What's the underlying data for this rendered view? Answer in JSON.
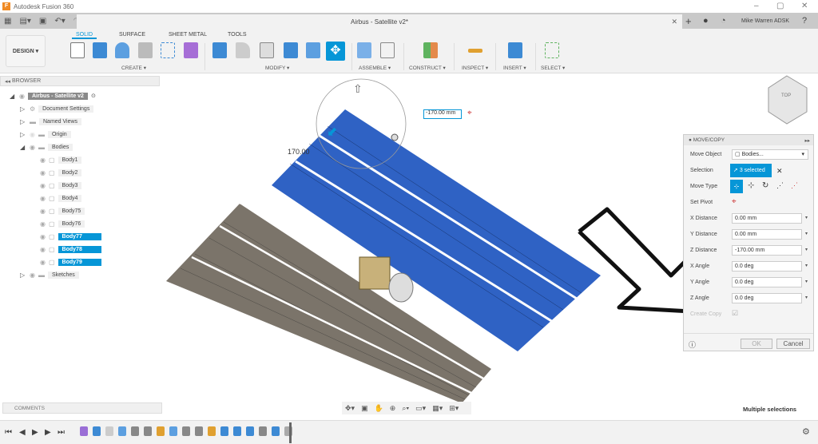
{
  "app": {
    "title": "Autodesk Fusion 360",
    "doc_tab": "Airbus - Satellite v2*",
    "user": "Mike Warren ADSK"
  },
  "toolbar": {
    "workspace": "DESIGN ▾",
    "tabs": [
      "SOLID",
      "SURFACE",
      "SHEET METAL",
      "TOOLS"
    ],
    "groups": [
      "CREATE ▾",
      "MODIFY ▾",
      "ASSEMBLE ▾",
      "CONSTRUCT ▾",
      "INSPECT ▾",
      "INSERT ▾",
      "SELECT ▾"
    ]
  },
  "browser": {
    "title": "BROWSER",
    "root": "Airbus - Satellite v2",
    "folders": [
      "Document Settings",
      "Named Views",
      "Origin",
      "Bodies",
      "Sketches"
    ],
    "bodies": [
      {
        "name": "Body1",
        "selected": false
      },
      {
        "name": "Body2",
        "selected": false
      },
      {
        "name": "Body3",
        "selected": false
      },
      {
        "name": "Body4",
        "selected": false
      },
      {
        "name": "Body75",
        "selected": false
      },
      {
        "name": "Body76",
        "selected": false
      },
      {
        "name": "Body77",
        "selected": true
      },
      {
        "name": "Body78",
        "selected": true
      },
      {
        "name": "Body79",
        "selected": true
      }
    ]
  },
  "viewport": {
    "distance_input": "-170.00 mm",
    "dim_label": "170.00",
    "viewcube": "TOP"
  },
  "move_copy": {
    "title": "MOVE/COPY",
    "move_object_label": "Move Object",
    "move_object": "Bodies...",
    "selection_label": "Selection",
    "selection": "3 selected",
    "move_type_label": "Move Type",
    "set_pivot_label": "Set Pivot",
    "fields": [
      {
        "label": "X Distance",
        "value": "0.00 mm"
      },
      {
        "label": "Y Distance",
        "value": "0.00 mm"
      },
      {
        "label": "Z Distance",
        "value": "-170.00 mm"
      },
      {
        "label": "X Angle",
        "value": "0.0 deg"
      },
      {
        "label": "Y Angle",
        "value": "0.0 deg"
      },
      {
        "label": "Z Angle",
        "value": "0.0 deg"
      }
    ],
    "create_copy_label": "Create Copy",
    "ok": "OK",
    "cancel": "Cancel"
  },
  "comments": "COMMENTS",
  "status": "Multiple selections"
}
